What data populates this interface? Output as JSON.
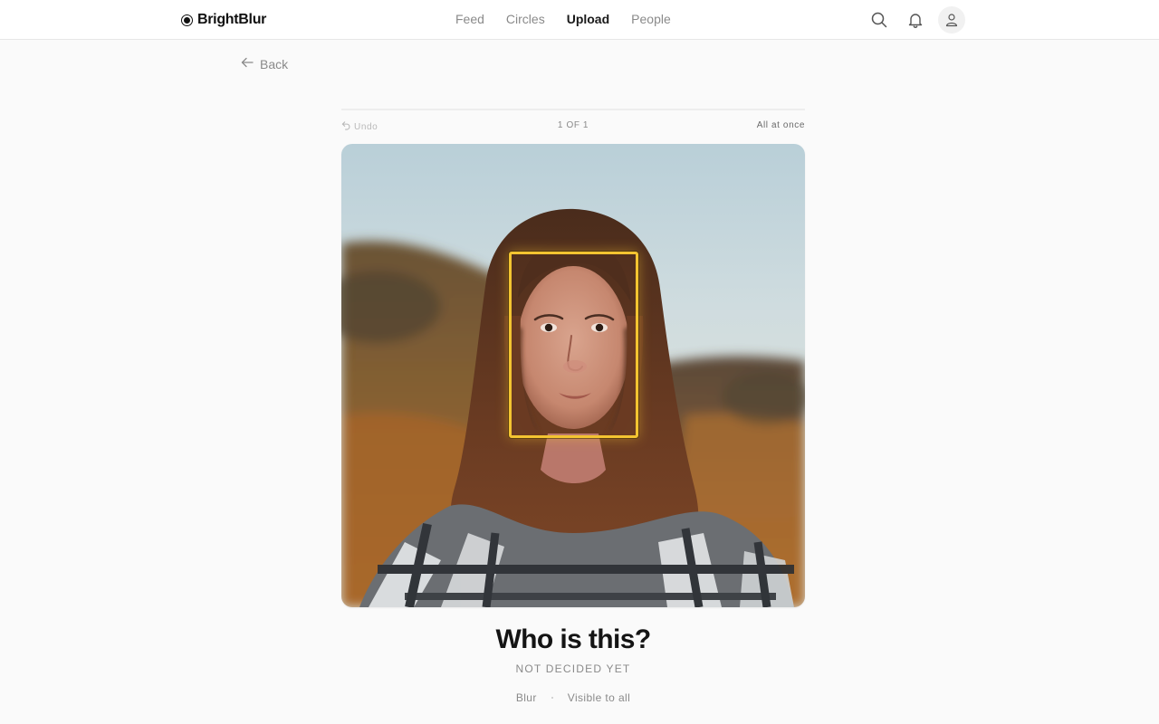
{
  "app": {
    "name": "BrightBlur"
  },
  "nav": {
    "items": [
      {
        "label": "Feed",
        "active": false
      },
      {
        "label": "Circles",
        "active": false
      },
      {
        "label": "Upload",
        "active": true
      },
      {
        "label": "People",
        "active": false
      }
    ]
  },
  "toolbar_icons": [
    "search-icon",
    "bell-icon",
    "user-icon"
  ],
  "back": {
    "label": "Back"
  },
  "editor": {
    "undo_label": "Undo",
    "counter": "1 OF 1",
    "mode_label": "All at once"
  },
  "question": {
    "title": "Who is this?",
    "status": "NOT DECIDED YET",
    "actions": [
      "Blur",
      "Visible to all"
    ]
  },
  "colors": {
    "accent": "#f3c431",
    "background": "#fafafa",
    "muted": "#8a8a8a"
  }
}
